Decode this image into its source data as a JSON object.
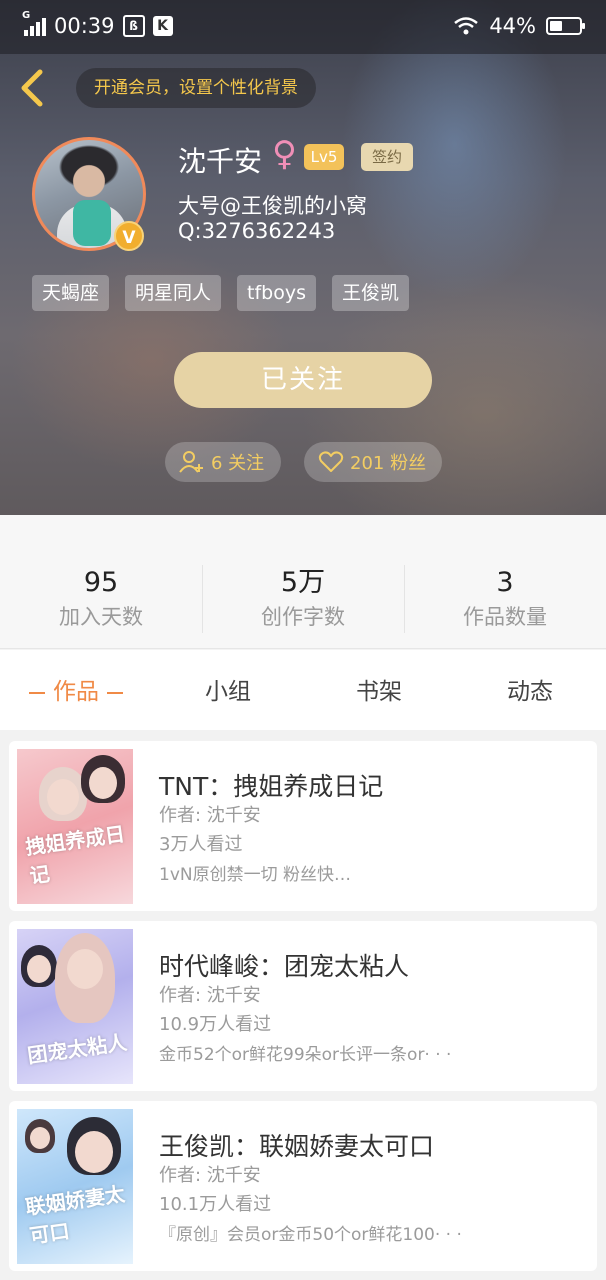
{
  "status_bar": {
    "network": "G",
    "time": "00:39",
    "battery_text": "44%",
    "battery_level": 0.44
  },
  "header": {
    "vip_banner": "开通会员，设置个性化背景"
  },
  "profile": {
    "name": "沈千安",
    "gender_symbol": "♀",
    "level": "Lv5",
    "signed": "签约",
    "verified_badge": "V",
    "alias": "大号@王俊凯的小窝",
    "qq": "Q:3276362243",
    "tags": [
      "天蝎座",
      "明星同人",
      "tfboys",
      "王俊凯"
    ],
    "follow_button": "已关注",
    "following_label": "6 关注",
    "fans_label": "201 粉丝"
  },
  "stats": [
    {
      "value": "95",
      "label": "加入天数"
    },
    {
      "value": "5万",
      "label": "创作字数"
    },
    {
      "value": "3",
      "label": "作品数量"
    }
  ],
  "tabs": [
    "作品",
    "小组",
    "书架",
    "动态"
  ],
  "works": [
    {
      "title": "TNT：拽姐养成日记",
      "author": "作者: 沈千安",
      "views": "3万人看过",
      "desc": "1vN原创禁一切  粉丝快…",
      "cover_text": "拽姐养成日记"
    },
    {
      "title": "时代峰峻：团宠太粘人",
      "author": "作者: 沈千安",
      "views": "10.9万人看过",
      "desc": "金币52个or鲜花99朵or长评一条or· · ·",
      "cover_text": "团宠太粘人"
    },
    {
      "title": "王俊凯：联姻娇妻太可口",
      "author": "作者: 沈千安",
      "views": "10.1万人看过",
      "desc": "『原创』会员or金币50个or鲜花100· · ·",
      "cover_text": "联姻娇妻太可口"
    }
  ],
  "colors": {
    "accent": "#f08a46",
    "gold": "#f3cd62",
    "follow_button_bg": "#e6d3a5",
    "vip_text": "#f5c84c"
  }
}
